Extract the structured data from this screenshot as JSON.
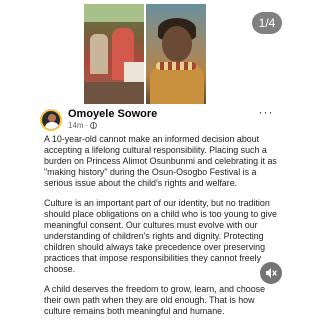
{
  "media": {
    "counter": "1/4",
    "images": [
      "festival-crowd-photo",
      "child-portrait-photo"
    ]
  },
  "post": {
    "author": "Omoyele Sowore",
    "time": "14m",
    "more_label": "···",
    "paragraphs": [
      "A 10-year-old cannot make an informed decision about accepting a lifelong cultural responsibility. Placing such a burden on Princess Alimot Osunbunmi and celebrating it as \"making history\" during the Osun-Osogbo Festival is a serious issue about the child's rights and welfare.",
      "Culture is an important part of our identity, but no tradition should place obligations on a child who is too young to give meaningful consent. Our cultures must evolve with our understanding of children's rights and dignity. Protecting children should always take precedence over preserving practices that impose responsibilities they cannot freely choose.",
      "A child deserves the freedom to grow, learn, and choose their own path when they are old enough. That is how culture remains both meaningful and humane."
    ]
  },
  "icons": {
    "globe": "globe-icon",
    "more": "more-options-icon",
    "mute": "speaker-muted-icon"
  }
}
